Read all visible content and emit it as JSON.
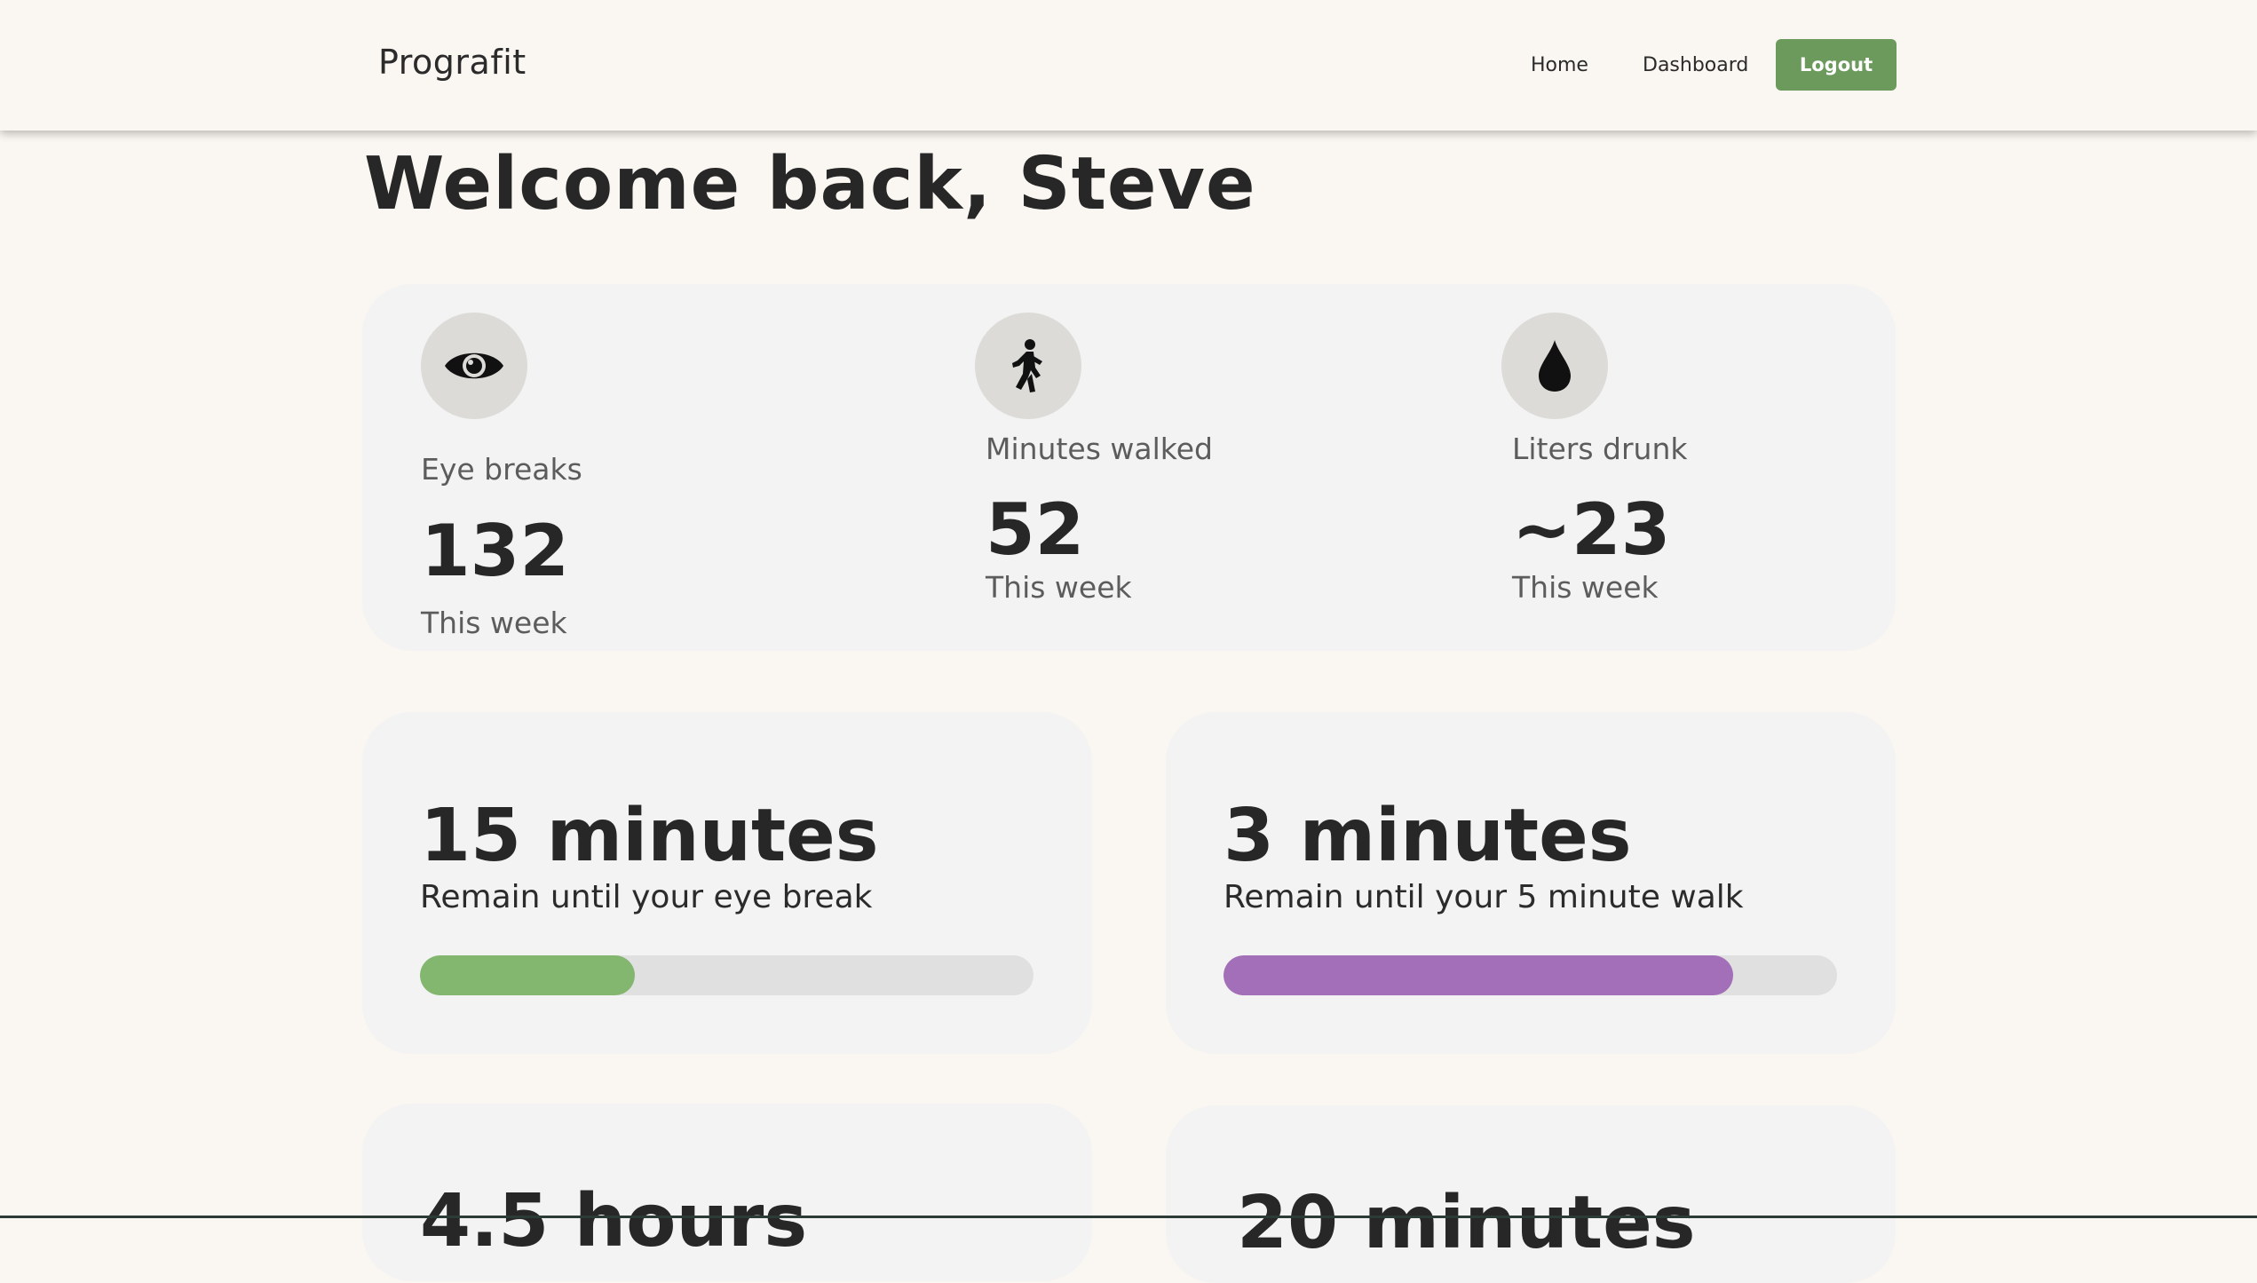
{
  "nav": {
    "brand": "Prografit",
    "links": [
      "Home",
      "Dashboard"
    ],
    "logout": "Logout"
  },
  "welcome": "Welcome back, Steve",
  "stats": [
    {
      "icon": "eye-icon",
      "label": "Eye breaks",
      "value": "132",
      "sub": "This week"
    },
    {
      "icon": "walking-person-icon",
      "label": "Minutes walked",
      "value": "52",
      "sub": "This week"
    },
    {
      "icon": "water-drop-icon",
      "label": "Liters drunk",
      "value": "~23",
      "sub": "This week"
    }
  ],
  "timers": [
    {
      "title": "15 minutes",
      "desc": "Remain until your eye break",
      "progress": 0.35,
      "color": "#83b76f"
    },
    {
      "title": "3 minutes",
      "desc": "Remain until your 5 minute walk",
      "progress": 0.83,
      "color": "#a26fb8"
    },
    {
      "title": "4.5 hours",
      "desc": "",
      "progress": null,
      "color": ""
    },
    {
      "title": "20 minutes",
      "desc": "",
      "progress": null,
      "color": ""
    }
  ]
}
